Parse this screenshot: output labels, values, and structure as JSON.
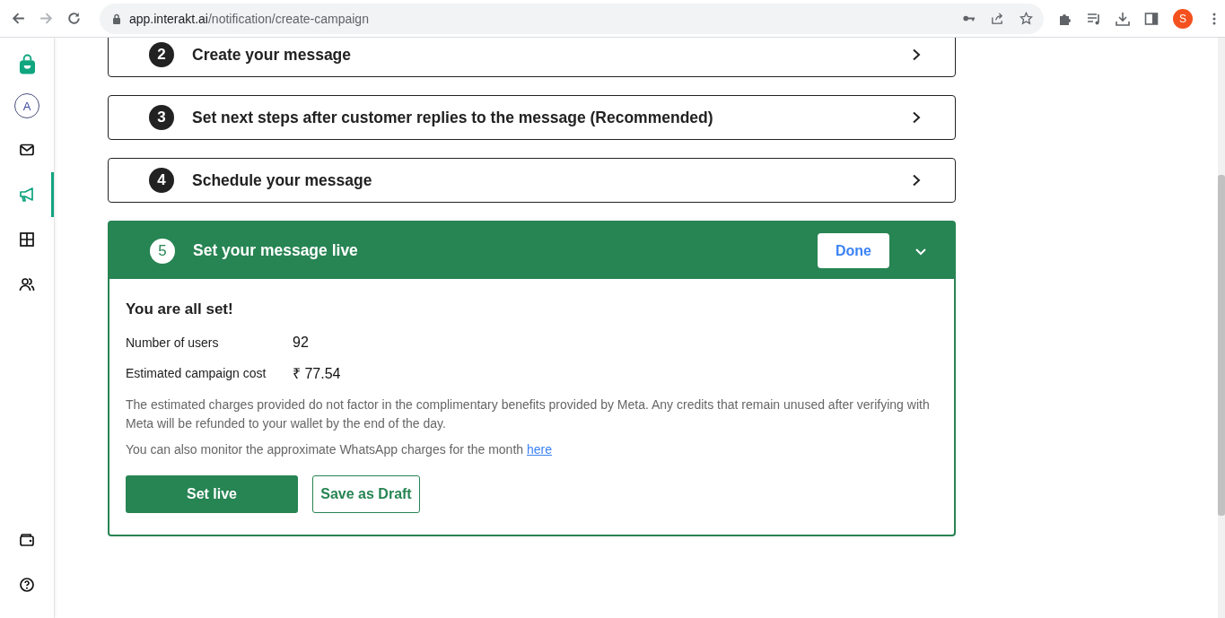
{
  "browser": {
    "url_host": "app.interakt.ai",
    "url_path": "/notification/create-campaign",
    "profile_initial": "S"
  },
  "sidebar": {
    "avatar_initial": "A",
    "items": [
      {
        "kind": "mail",
        "selected": false
      },
      {
        "kind": "megaphone",
        "selected": true
      },
      {
        "kind": "grid",
        "selected": false
      },
      {
        "kind": "users",
        "selected": false
      }
    ],
    "bottom_items": [
      {
        "kind": "wallet",
        "selected": false
      },
      {
        "kind": "help",
        "selected": false
      }
    ]
  },
  "steps": [
    {
      "number": "2",
      "title": "Create your message",
      "expanded": false
    },
    {
      "number": "3",
      "title": "Set next steps after customer replies to the message (Recommended)",
      "expanded": false
    },
    {
      "number": "4",
      "title": "Schedule your message",
      "expanded": false
    },
    {
      "number": "5",
      "title": "Set your message live",
      "expanded": true,
      "done_button": "Done"
    }
  ],
  "summary": {
    "heading": "You are all set!",
    "rows": [
      {
        "label": "Number of users",
        "value": "92"
      },
      {
        "label": "Estimated campaign cost",
        "value": "₹ 77.54"
      }
    ],
    "note": "The estimated charges provided do not factor in the complimentary benefits provided by Meta. Any credits that remain unused after verifying with Meta will be refunded to your wallet by the end of the day.",
    "monitor_text": "You can also monitor the approximate WhatsApp charges for the month",
    "monitor_link": "here",
    "primary_button": "Set live",
    "secondary_button": "Save as Draft"
  }
}
